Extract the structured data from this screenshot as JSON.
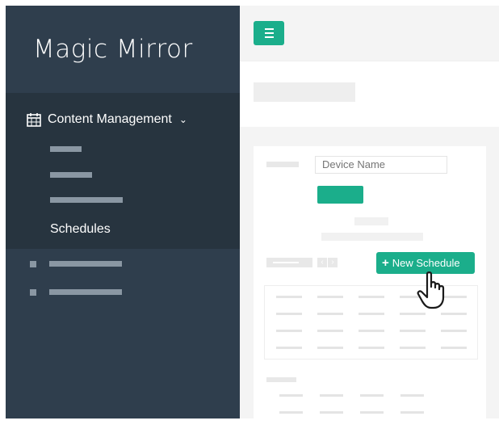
{
  "app": {
    "title": "Magic Mirror"
  },
  "sidebar": {
    "section_label": "Content Management",
    "section_icon": "calendar-icon",
    "chevron_icon": "chevron-down-icon",
    "active_item_label": "Schedules"
  },
  "toolbar": {
    "menu_icon": "hamburger-icon"
  },
  "form": {
    "device_name_placeholder": "Device Name"
  },
  "actions": {
    "new_schedule_label": "New Schedule",
    "new_schedule_icon": "plus-icon"
  },
  "colors": {
    "accent": "#1bae8b",
    "sidebar_bg": "#2f3e4d",
    "sidebar_section_bg": "#27343f",
    "page_bg": "#f4f4f4"
  },
  "pointer": {
    "icon": "hand-pointer-icon"
  }
}
